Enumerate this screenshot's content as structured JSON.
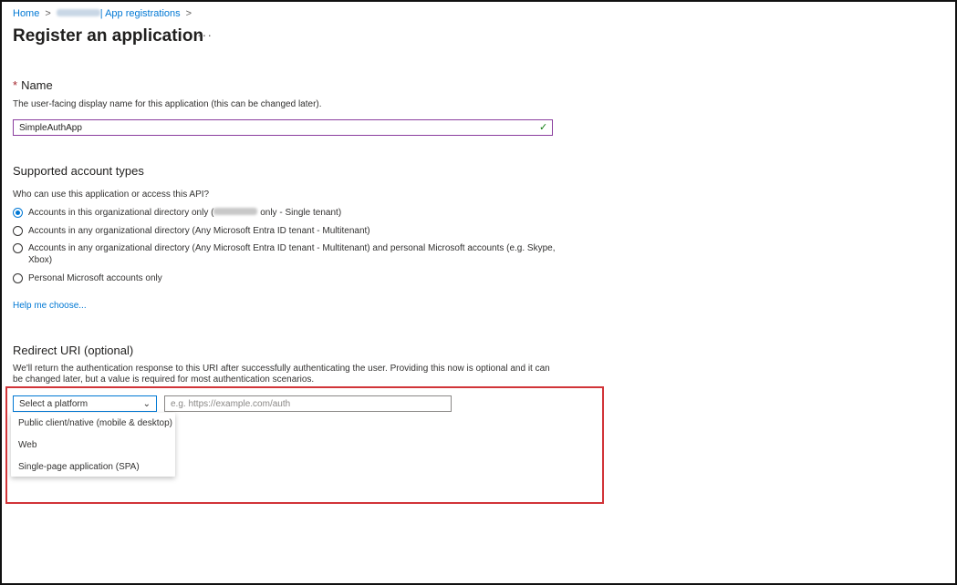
{
  "breadcrumb": {
    "home": "Home",
    "tenant": "",
    "app_registrations": "| App registrations"
  },
  "page": {
    "title": "Register an application",
    "more": "···"
  },
  "name_section": {
    "required_marker": "*",
    "heading": "Name",
    "description": "The user-facing display name for this application (this can be changed later).",
    "value": "SimpleAuthApp"
  },
  "account_types": {
    "heading": "Supported account types",
    "question": "Who can use this application or access this API?",
    "options": [
      {
        "label_prefix": "Accounts in this organizational directory only (",
        "label_suffix": " only - Single tenant)",
        "selected": true
      },
      {
        "label": "Accounts in any organizational directory (Any Microsoft Entra ID tenant - Multitenant)",
        "selected": false
      },
      {
        "label": "Accounts in any organizational directory (Any Microsoft Entra ID tenant - Multitenant) and personal Microsoft accounts (e.g. Skype, Xbox)",
        "selected": false
      },
      {
        "label": "Personal Microsoft accounts only",
        "selected": false
      }
    ],
    "help_link": "Help me choose..."
  },
  "redirect": {
    "heading": "Redirect URI (optional)",
    "description": "We'll return the authentication response to this URI after successfully authenticating the user. Providing this now is optional and it can be changed later, but a value is required for most authentication scenarios.",
    "platform_placeholder": "Select a platform",
    "uri_placeholder": "e.g. https://example.com/auth",
    "platform_options": [
      "Public client/native (mobile & desktop)",
      "Web",
      "Single-page application (SPA)"
    ]
  },
  "colors": {
    "link": "#0078d4",
    "highlight_border": "#d13438",
    "input_focus": "#8a3d9e",
    "success": "#107c10"
  },
  "icons": {
    "check": "checkmark-icon",
    "chevron": "chevron-down-icon"
  }
}
